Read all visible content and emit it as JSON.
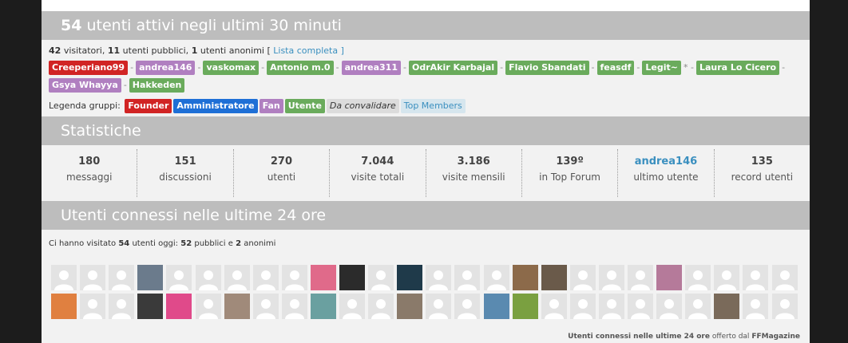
{
  "online": {
    "header_count": "54",
    "header_text": "utenti attivi negli ultimi 30 minuti",
    "visitors": "42",
    "visitors_label": "visitatori,",
    "public": "11",
    "public_label": "utenti pubblici,",
    "anon": "1",
    "anon_label": "utenti anonimi [",
    "full_list": "Lista completa",
    "close_bracket": "]",
    "users": [
      {
        "name": "Creeperiano99",
        "color": "#d12424"
      },
      {
        "name": "andrea146",
        "color": "#b07fc0"
      },
      {
        "name": "vaskomax",
        "color": "#6aab5c"
      },
      {
        "name": "Antonio m.0",
        "color": "#6aab5c"
      },
      {
        "name": "andrea311",
        "color": "#b07fc0"
      },
      {
        "name": "OdrAkir Karbajal",
        "color": "#6aab5c"
      },
      {
        "name": "Flavio Sbandati",
        "color": "#6aab5c"
      },
      {
        "name": "feasdf",
        "color": "#6aab5c"
      },
      {
        "name": "Legit~",
        "color": "#6aab5c"
      },
      {
        "name": "Laura Lo Cicero",
        "color": "#6aab5c"
      },
      {
        "name": "Gsya Whayya",
        "color": "#b07fc0"
      },
      {
        "name": "Hakkeden",
        "color": "#6aab5c"
      }
    ],
    "legend_label": "Legenda gruppi:",
    "legend": [
      {
        "name": "Founder",
        "color": "#d12424",
        "text": "#ffffff"
      },
      {
        "name": "Amministratore",
        "color": "#1e6fd6",
        "text": "#ffffff"
      },
      {
        "name": "Fan",
        "color": "#b07fc0",
        "text": "#ffffff"
      },
      {
        "name": "Utente",
        "color": "#6aab5c",
        "text": "#ffffff"
      },
      {
        "name": "Da convalidare",
        "color": "#dcdcdc",
        "text": "#333333"
      },
      {
        "name": "Top Members",
        "color": "#d6e6ee",
        "text": "#3a8fbf"
      }
    ]
  },
  "stats": {
    "title": "Statistiche",
    "items": [
      {
        "value": "180",
        "label": "messaggi"
      },
      {
        "value": "151",
        "label": "discussioni"
      },
      {
        "value": "270",
        "label": "utenti"
      },
      {
        "value": "7.044",
        "label": "visite totali"
      },
      {
        "value": "3.186",
        "label": "visite mensili"
      },
      {
        "value": "139º",
        "label": "in Top Forum"
      },
      {
        "value": "andrea146",
        "label": "ultimo utente",
        "link": true
      },
      {
        "value": "135",
        "label": "record utenti"
      }
    ]
  },
  "day": {
    "title": "Utenti connessi nelle ultime 24 ore",
    "intro": "Ci hanno visitato",
    "total": "54",
    "today_label": "utenti oggi:",
    "public": "52",
    "public_label": "pubblici e",
    "anon": "2",
    "anon_label": "anonimi",
    "footer_bold": "Utenti connessi nelle ultime 24 ore",
    "footer_text": "offerto dal",
    "footer_brand": "FFMagazine"
  }
}
